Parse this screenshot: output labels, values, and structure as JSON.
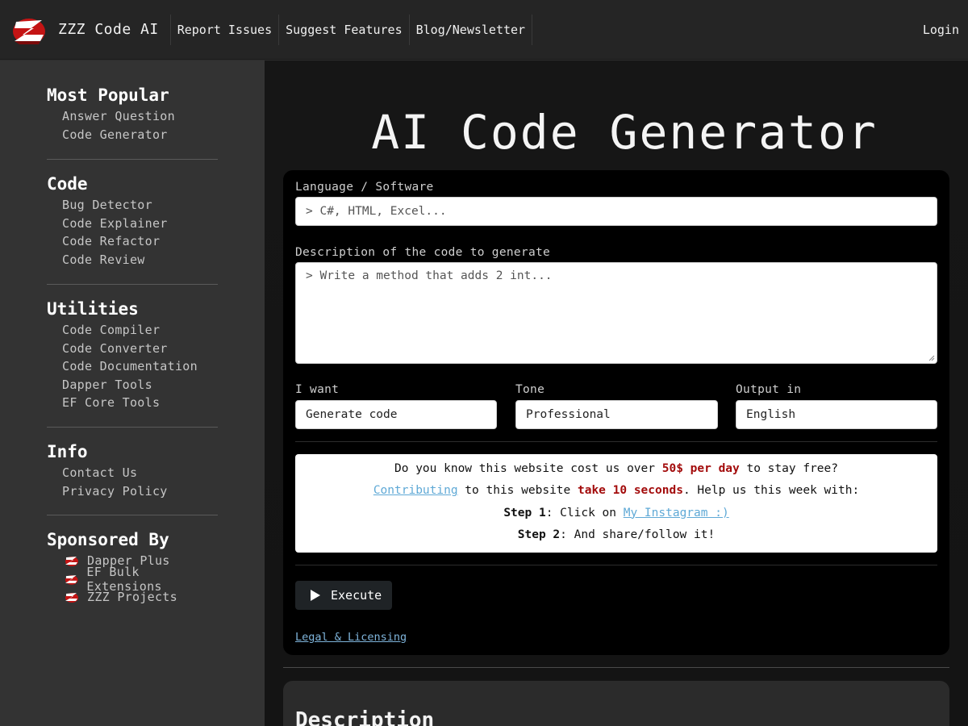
{
  "header": {
    "brand": "ZZZ Code AI",
    "nav": [
      "Report Issues",
      "Suggest Features",
      "Blog/Newsletter"
    ],
    "login": "Login"
  },
  "sidebar": {
    "most_popular": {
      "title": "Most Popular",
      "items": [
        "Answer Question",
        "Code Generator"
      ]
    },
    "code": {
      "title": "Code",
      "items": [
        "Bug Detector",
        "Code Explainer",
        "Code Refactor",
        "Code Review"
      ]
    },
    "utilities": {
      "title": "Utilities",
      "items": [
        "Code Compiler",
        "Code Converter",
        "Code Documentation",
        "Dapper Tools",
        "EF Core Tools"
      ]
    },
    "info": {
      "title": "Info",
      "items": [
        "Contact Us",
        "Privacy Policy"
      ]
    },
    "sponsored": {
      "title": "Sponsored By",
      "items": [
        "Dapper Plus",
        "EF Bulk Extensions",
        "ZZZ Projects"
      ]
    }
  },
  "main": {
    "title": "AI Code Generator",
    "form": {
      "language_label": "Language / Software",
      "language_placeholder": "> C#, HTML, Excel...",
      "description_label": "Description of the code to generate",
      "description_placeholder": "> Write a method that adds 2 int...",
      "want_label": "I want",
      "want_value": "Generate code",
      "tone_label": "Tone",
      "tone_value": "Professional",
      "output_label": "Output in",
      "output_value": "English"
    },
    "notice": {
      "l1_a": "Do you know this website cost us over ",
      "l1_b": "50$ per day",
      "l1_c": " to stay free?",
      "l2_link": "Contributing",
      "l2_a": " to this website ",
      "l2_b": "take 10 seconds",
      "l2_c": ". Help us this week with:",
      "l3_bold": "Step 1",
      "l3_a": ": Click on ",
      "l3_link": "My Instagram :)",
      "l4_bold": "Step 2",
      "l4_a": ": And share/follow it!"
    },
    "execute_label": "Execute",
    "legal_label": "Legal & Licensing",
    "description_heading": "Description"
  },
  "colors": {
    "accent_red": "#a30c0c",
    "link_blue": "#5fa9d6",
    "sidebar_bg": "#333333",
    "card_bg": "#000000"
  }
}
